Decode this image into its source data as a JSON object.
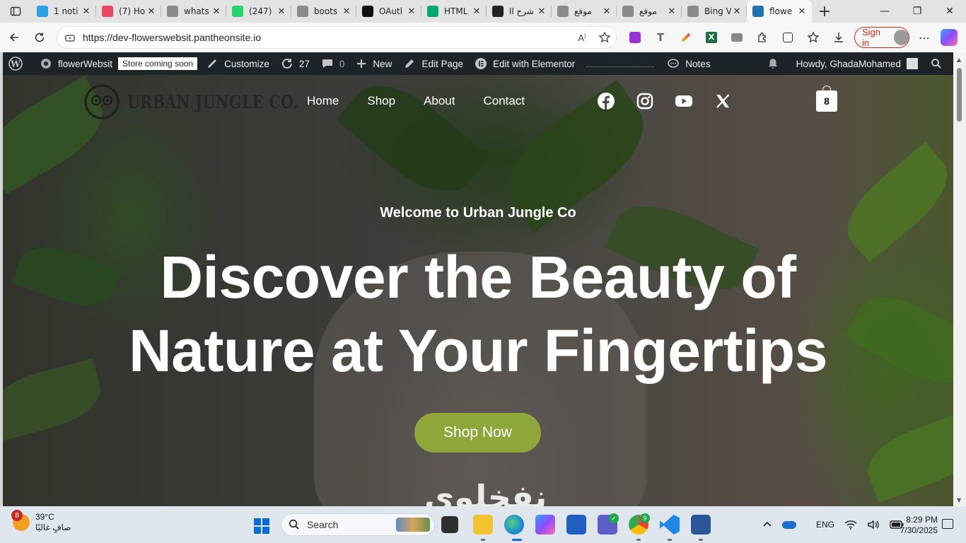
{
  "browser": {
    "tabs": [
      {
        "title": "1 noti",
        "icon": "telegram-icon",
        "color": "#2aa3e0"
      },
      {
        "title": "(7) Ho",
        "icon": "youtube-icon",
        "color": "#e8475f"
      },
      {
        "title": "whats",
        "icon": "search-icon",
        "color": "#8a8a8a"
      },
      {
        "title": "(247)",
        "icon": "whatsapp-icon",
        "color": "#25d366"
      },
      {
        "title": "boots",
        "icon": "search-icon",
        "color": "#8a8a8a"
      },
      {
        "title": "OAutl",
        "icon": "github-icon",
        "color": "#111111"
      },
      {
        "title": "HTML",
        "icon": "w3schools-icon",
        "color": "#04aa6d"
      },
      {
        "title": "شرح اا",
        "icon": "openai-icon",
        "color": "#222222"
      },
      {
        "title": "موقع",
        "icon": "search-icon",
        "color": "#8a8a8a"
      },
      {
        "title": "موقع",
        "icon": "search-icon",
        "color": "#8a8a8a"
      },
      {
        "title": "Bing V",
        "icon": "search-icon",
        "color": "#8a8a8a"
      },
      {
        "title": "flowe",
        "icon": "wordpress-icon",
        "color": "#2271b1",
        "active": true
      }
    ],
    "url": "https://dev-flowerswebsit.pantheonsite.io",
    "signin_label": "Sign in"
  },
  "wpbar": {
    "site_name": "flowerWebsit",
    "store_badge": "Store coming soon",
    "customize": "Customize",
    "updates_count": "27",
    "comments_count": "0",
    "new": "New",
    "edit_page": "Edit Page",
    "edit_elementor": "Edit with Elementor",
    "notes": "Notes",
    "howdy": "Howdy, GhadaMohamed"
  },
  "site": {
    "brand": "URBAN JUNGLE CO.",
    "nav": [
      "Home",
      "Shop",
      "About",
      "Contact"
    ],
    "social": [
      "facebook-icon",
      "instagram-icon",
      "youtube-icon",
      "x-icon"
    ],
    "cart_count": "8",
    "subtitle": "Welcome to Urban Jungle Co",
    "headline_line1": "Discover the Beauty of",
    "headline_line2": "Nature at Your Fingertips",
    "cta": "Shop Now",
    "overlay_text": "نفخلوي"
  },
  "taskbar": {
    "weather_badge": "8",
    "temperature": "39°C",
    "weather_desc": "صافٍ غالبًا",
    "search_placeholder": "Search",
    "language": "ENG",
    "time": "8:29 PM",
    "date": "7/30/2025",
    "teams_badge": "",
    "chrome_badge": "9"
  },
  "colors": {
    "wp_bar": "#1d2327",
    "cta_green": "#8ea63a",
    "signin_red": "#c42b1c"
  }
}
